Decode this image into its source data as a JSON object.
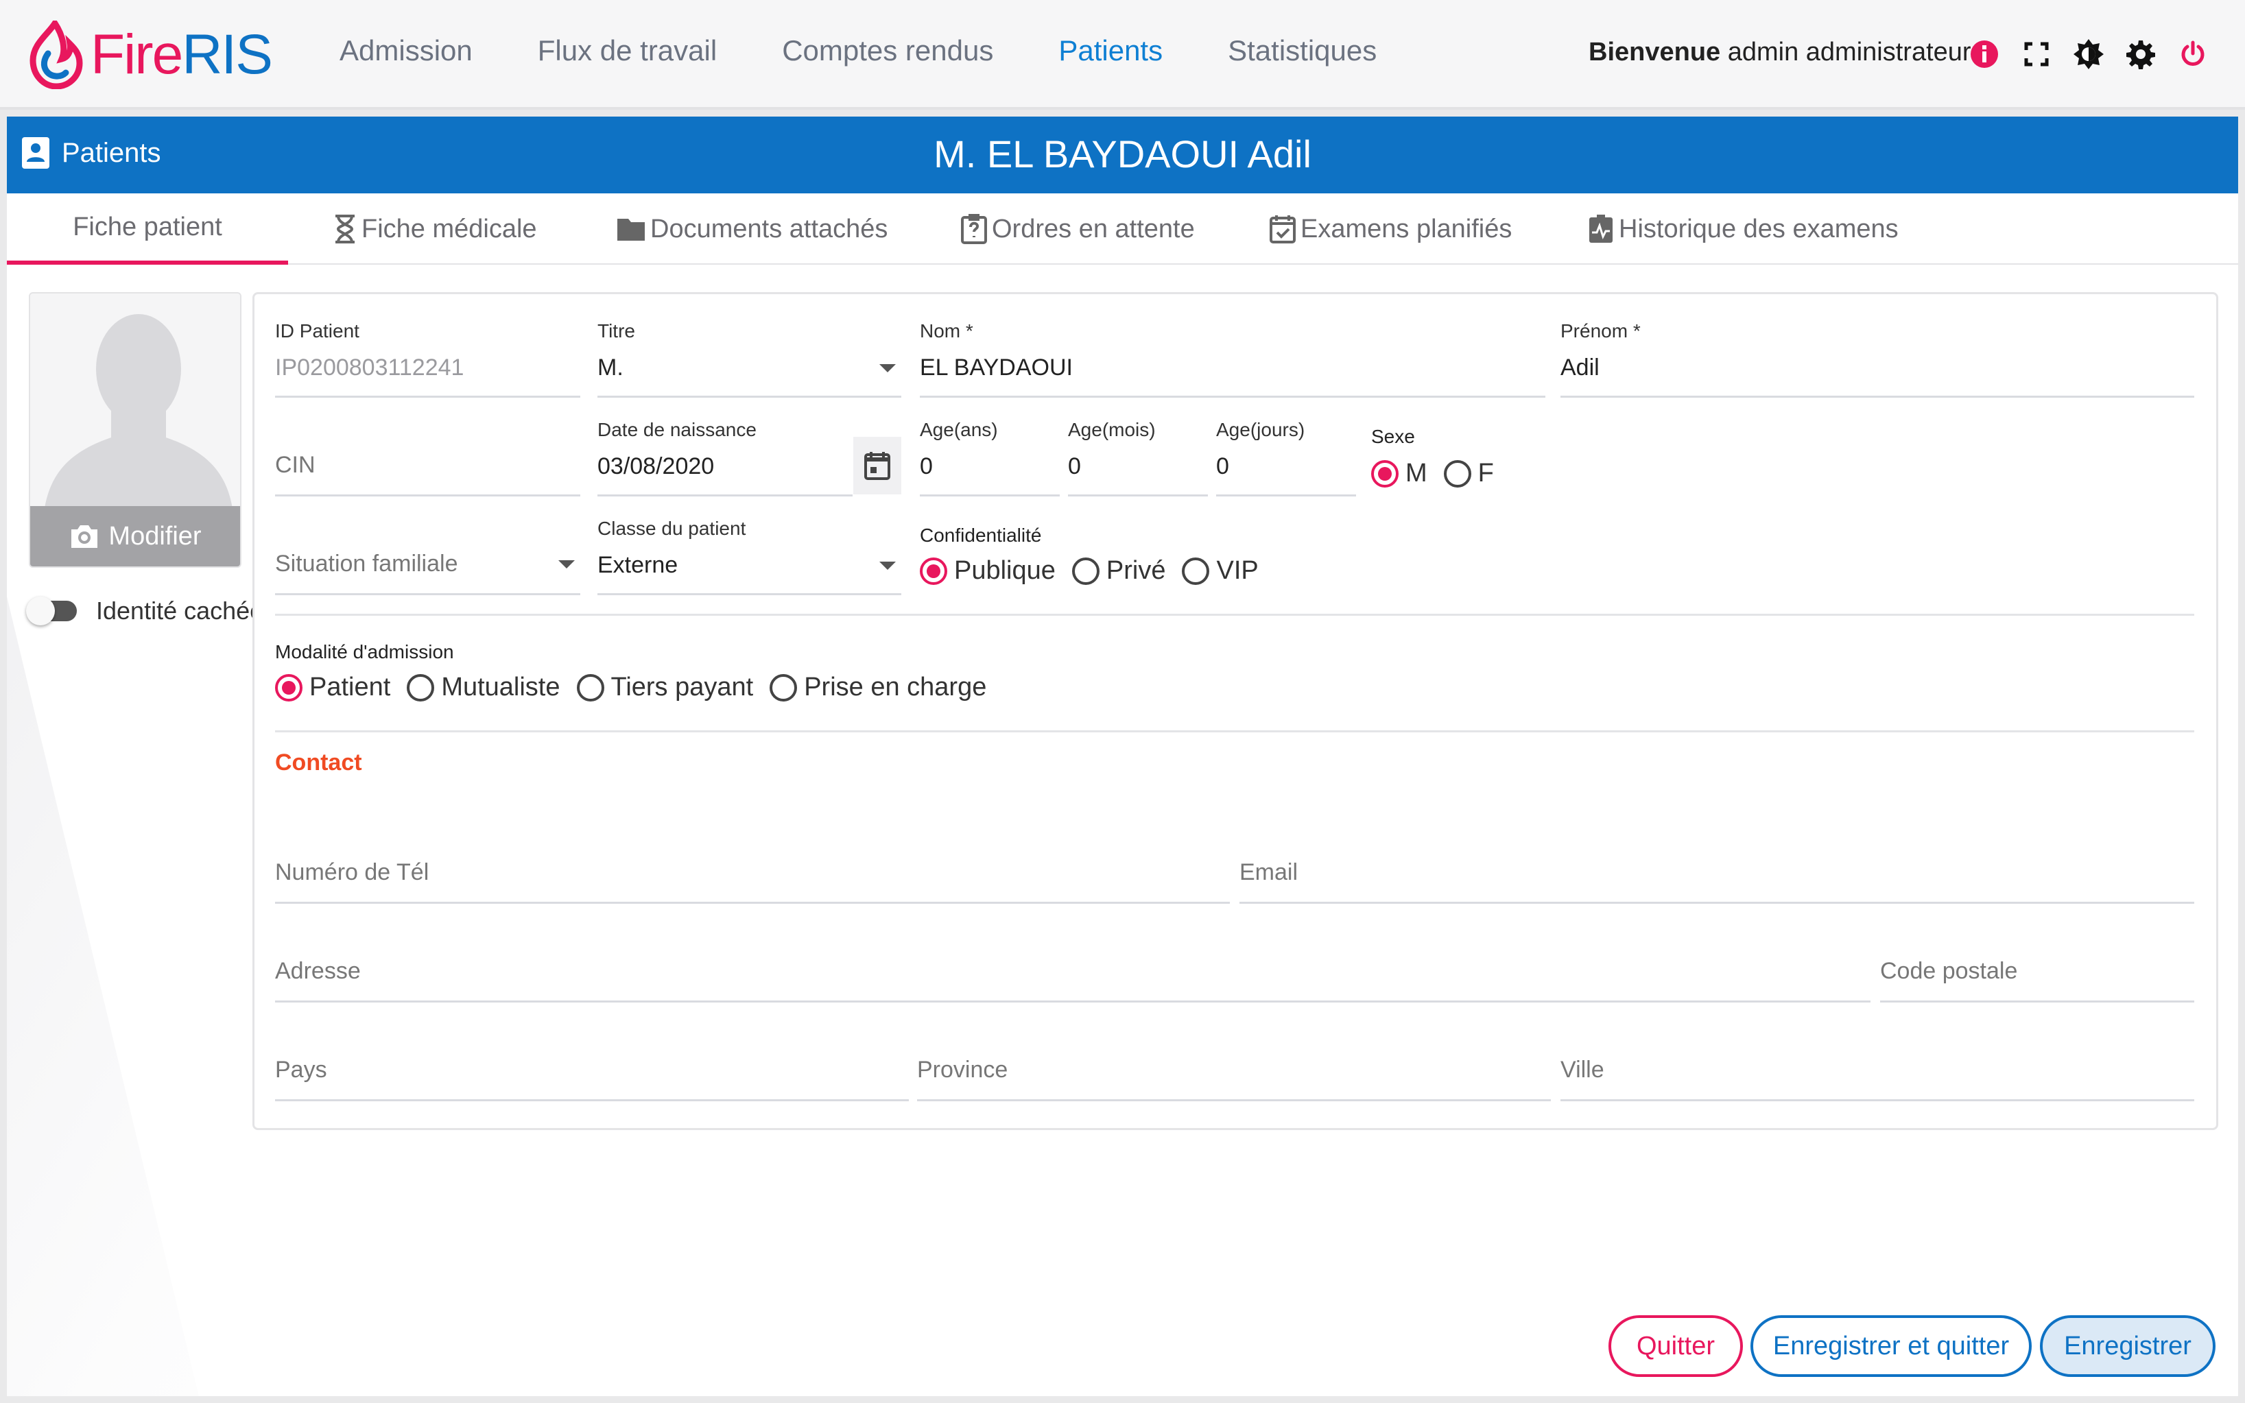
{
  "app": {
    "logo_fire": "Fire",
    "logo_ris": "RIS",
    "brand_pink": "#e8175d",
    "brand_blue": "#0e72c4"
  },
  "nav": {
    "items": [
      "Admission",
      "Flux de travail",
      "Comptes rendus",
      "Patients",
      "Statistiques"
    ],
    "active": "Patients"
  },
  "user": {
    "welcome_bold": "Bienvenue",
    "welcome_name": " admin administrateur"
  },
  "top_icons": [
    "info-icon",
    "fullscreen-icon",
    "theme-icon",
    "gear-icon",
    "power-icon"
  ],
  "header": {
    "section": "Patients",
    "title": "M. EL BAYDAOUI Adil"
  },
  "tabs": [
    {
      "label": "Fiche patient",
      "icon": "",
      "active": true
    },
    {
      "label": "Fiche médicale",
      "icon": "hourglass-icon"
    },
    {
      "label": "Documents attachés",
      "icon": "folder-icon"
    },
    {
      "label": "Ordres en attente",
      "icon": "clipboard-question-icon"
    },
    {
      "label": "Examens planifiés",
      "icon": "calendar-check-icon"
    },
    {
      "label": "Historique des examens",
      "icon": "clipboard-pulse-icon"
    }
  ],
  "avatar": {
    "modify_label": "Modifier"
  },
  "identity": {
    "label": "Identité cachée",
    "enabled": false
  },
  "form": {
    "id_patient": {
      "label": "ID Patient",
      "value": "IP0200803112241"
    },
    "titre": {
      "label": "Titre",
      "value": "M."
    },
    "nom": {
      "label": "Nom *",
      "value": "EL BAYDAOUI"
    },
    "prenom": {
      "label": "Prénom *",
      "value": "Adil"
    },
    "cin": {
      "placeholder": "CIN"
    },
    "date_naissance": {
      "label": "Date de naissance",
      "value": "03/08/2020"
    },
    "age_ans": {
      "label": "Age(ans)",
      "value": "0"
    },
    "age_mois": {
      "label": "Age(mois)",
      "value": "0"
    },
    "age_jours": {
      "label": "Age(jours)",
      "value": "0"
    },
    "sexe": {
      "label": "Sexe",
      "options": [
        "M",
        "F"
      ],
      "selected": "M"
    },
    "situation": {
      "placeholder": "Situation familiale"
    },
    "classe": {
      "label": "Classe du patient",
      "value": "Externe"
    },
    "confidentialite": {
      "label": "Confidentialité",
      "options": [
        "Publique",
        "Privé",
        "VIP"
      ],
      "selected": "Publique"
    },
    "modalite": {
      "label": "Modalité d'admission",
      "options": [
        "Patient",
        "Mutualiste",
        "Tiers payant",
        "Prise en charge"
      ],
      "selected": "Patient"
    },
    "contact_title": "Contact",
    "tel": {
      "placeholder": "Numéro de Tél"
    },
    "email": {
      "placeholder": "Email"
    },
    "adresse": {
      "placeholder": "Adresse"
    },
    "code_postal": {
      "placeholder": "Code postale"
    },
    "pays": {
      "placeholder": "Pays"
    },
    "province": {
      "placeholder": "Province"
    },
    "ville": {
      "placeholder": "Ville"
    }
  },
  "buttons": {
    "quit": "Quitter",
    "save_quit": "Enregistrer et quitter",
    "save": "Enregistrer"
  }
}
